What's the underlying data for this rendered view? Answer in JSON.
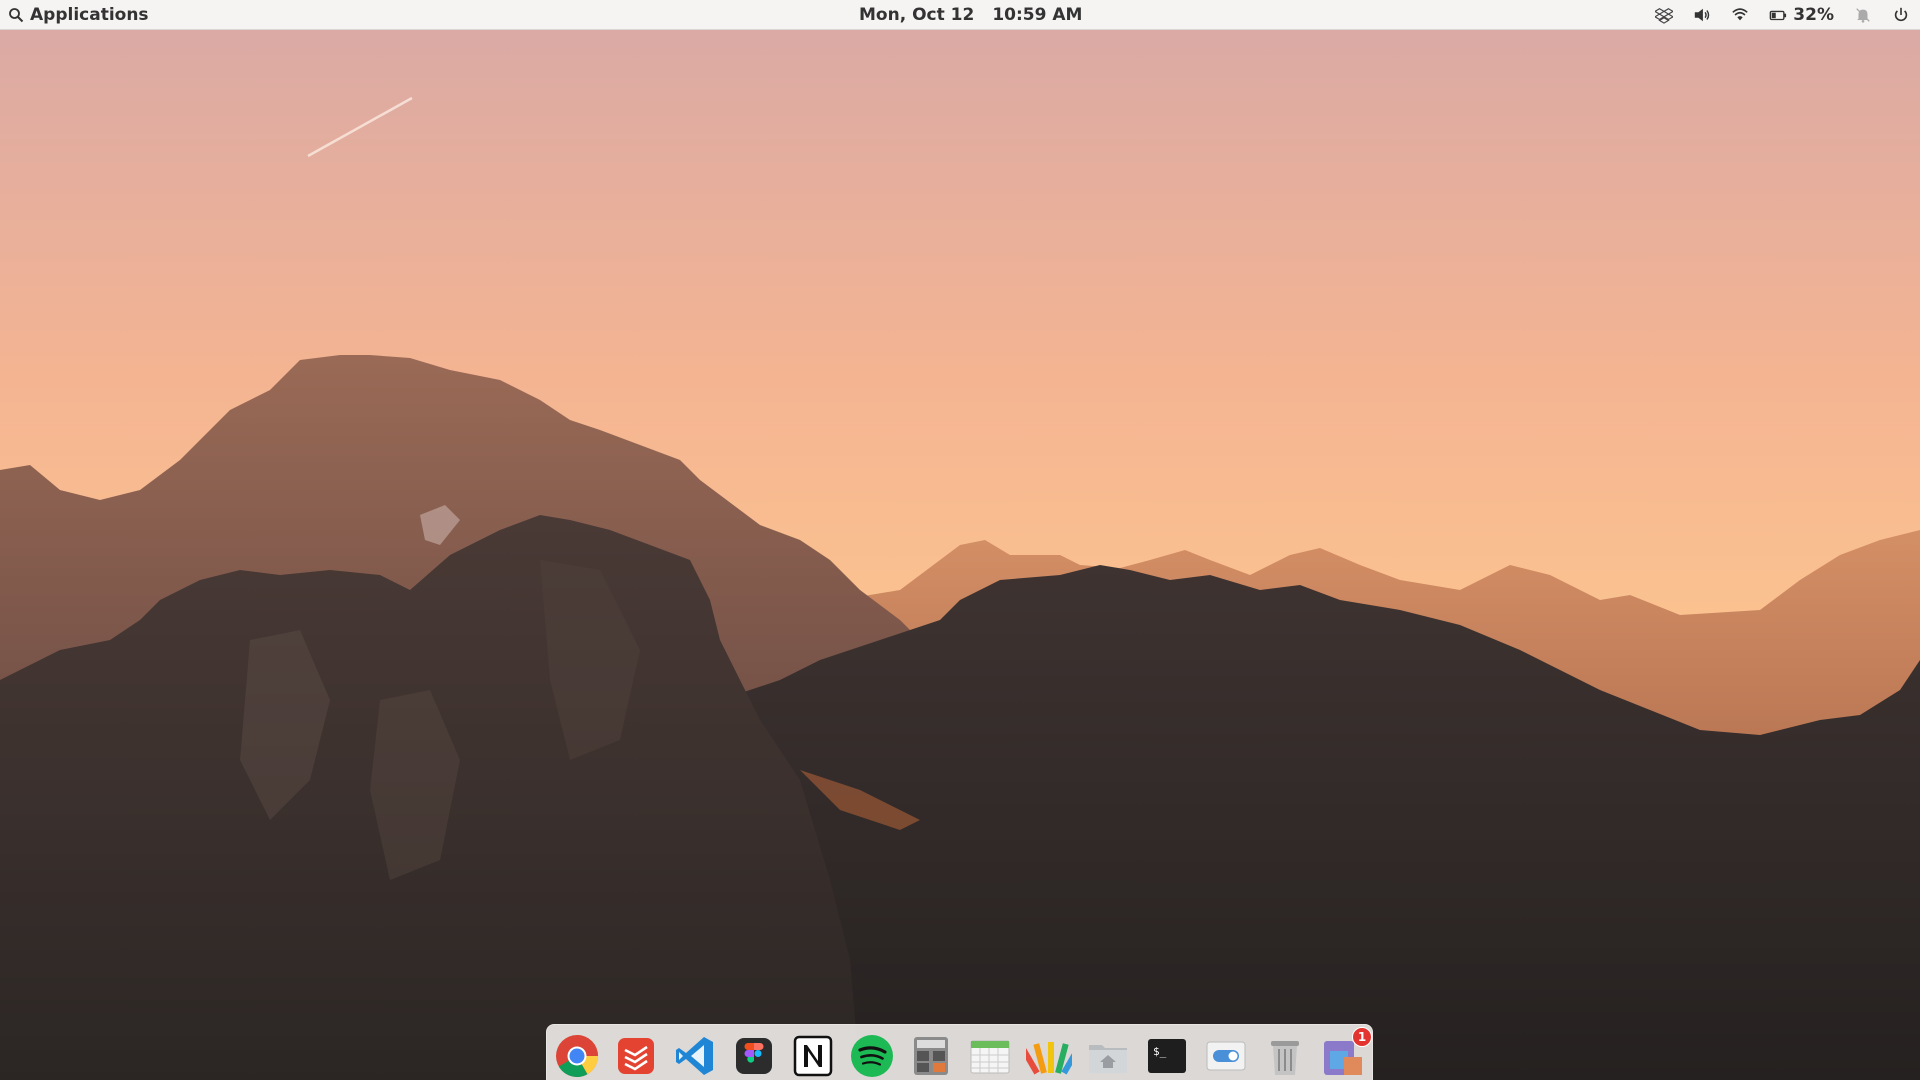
{
  "panel": {
    "applications_label": "Applications",
    "date": "Mon, Oct 12",
    "time": "10:59 AM",
    "battery_percent": "32%",
    "indicators": [
      "dropbox-icon",
      "volume-icon",
      "wifi-icon",
      "battery-icon",
      "notifications-off-icon",
      "power-icon"
    ]
  },
  "dock": {
    "items": [
      {
        "name": "chrome",
        "icon": "chrome-icon",
        "running": true
      },
      {
        "name": "todoist",
        "icon": "todoist-icon",
        "running": false
      },
      {
        "name": "vscode",
        "icon": "vscode-icon",
        "running": true
      },
      {
        "name": "figma",
        "icon": "figma-icon",
        "running": true
      },
      {
        "name": "notion",
        "icon": "notion-icon",
        "running": true
      },
      {
        "name": "spotify",
        "icon": "spotify-icon",
        "running": false
      },
      {
        "name": "calculator",
        "icon": "calculator-icon",
        "running": false
      },
      {
        "name": "calendar",
        "icon": "calendar-icon",
        "running": false
      },
      {
        "name": "color-picker",
        "icon": "color-picker-icon",
        "running": false
      },
      {
        "name": "files",
        "icon": "files-icon",
        "running": true
      },
      {
        "name": "terminal",
        "icon": "terminal-icon",
        "running": true
      },
      {
        "name": "settings",
        "icon": "settings-toggle-icon",
        "running": false
      },
      {
        "name": "trash",
        "icon": "trash-icon",
        "running": false
      },
      {
        "name": "appcenter",
        "icon": "appcenter-icon",
        "running": false,
        "badge": "1"
      }
    ]
  },
  "colors": {
    "panel_bg": "#f6f4f3",
    "sky_top": "#d9a9a7",
    "sky_bottom": "#fbc28e",
    "accent_dot": "#3a89e8",
    "badge": "#e3342f"
  }
}
